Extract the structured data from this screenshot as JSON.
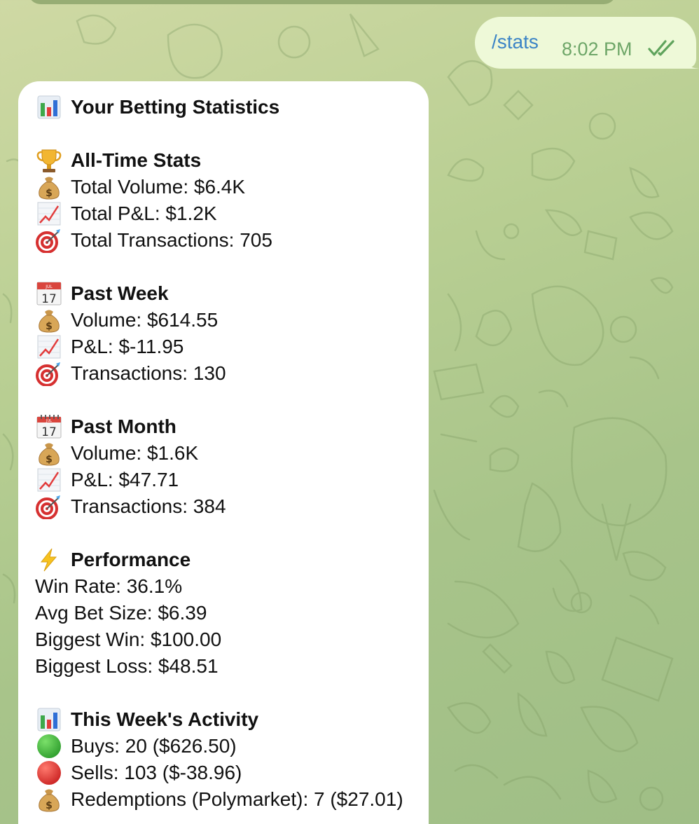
{
  "outgoing": {
    "text": "/stats",
    "time": "8:02 PM",
    "status_icon": "double-check-icon"
  },
  "stats": {
    "title": "Your Betting Statistics",
    "all_time": {
      "header": "All-Time Stats",
      "volume": "Total Volume: $6.4K",
      "pnl": "Total P&L: $1.2K",
      "transactions": "Total Transactions: 705"
    },
    "past_week": {
      "header": "Past Week",
      "volume": "Volume: $614.55",
      "pnl": "P&L: $-11.95",
      "transactions": "Transactions: 130"
    },
    "past_month": {
      "header": "Past Month",
      "volume": "Volume: $1.6K",
      "pnl": "P&L: $47.71",
      "transactions": "Transactions: 384"
    },
    "performance": {
      "header": "Performance",
      "win_rate": "Win Rate: 36.1%",
      "avg_bet": "Avg Bet Size: $6.39",
      "biggest_win": "Biggest Win: $100.00",
      "biggest_loss": "Biggest Loss: $48.51"
    },
    "week_activity": {
      "header": "This Week's Activity",
      "buys": "Buys: 20 ($626.50)",
      "sells": "Sells: 103 ($-38.96)",
      "redemptions": "Redemptions (Polymarket): 7 ($27.01)"
    }
  },
  "colors": {
    "outgoing_bubble": "#eef9d8",
    "outgoing_text": "#3b84c6",
    "time_text": "#6ea668",
    "incoming_bubble": "#ffffff",
    "chat_background": "#b9cf93"
  }
}
